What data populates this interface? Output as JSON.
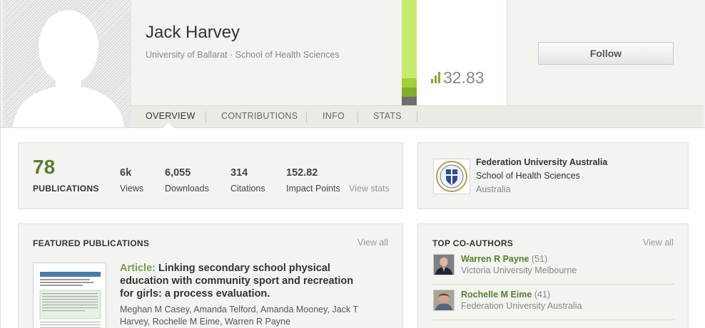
{
  "profile": {
    "name": "Jack Harvey",
    "affiliation": "University of Ballarat · School of Health Sciences",
    "score": "32.83",
    "follow_label": "Follow"
  },
  "tabs": [
    {
      "label": "OVERVIEW",
      "active": true
    },
    {
      "label": "CONTRIBUTIONS",
      "active": false
    },
    {
      "label": "INFO",
      "active": false
    },
    {
      "label": "STATS",
      "active": false
    }
  ],
  "stats": {
    "publications_count": "78",
    "publications_label": "PUBLICATIONS",
    "items": [
      {
        "value": "6k",
        "label": "Views"
      },
      {
        "value": "6,055",
        "label": "Downloads"
      },
      {
        "value": "314",
        "label": "Citations"
      },
      {
        "value": "152.82",
        "label": "Impact Points"
      }
    ],
    "view_stats_label": "View stats"
  },
  "institution": {
    "name": "Federation University Australia",
    "department": "School of Health Sciences",
    "country": "Australia"
  },
  "featured": {
    "title": "FEATURED PUBLICATIONS",
    "view_all": "View all",
    "article_type": "Article:",
    "article_title": "Linking secondary school physical education with community sport and recreation for girls: a process evaluation.",
    "authors": "Meghan M Casey, Amanda Telford, Amanda Mooney, Jack T Harvey, Rochelle M Eime, Warren R Payne"
  },
  "coauthors": {
    "title": "TOP CO-AUTHORS",
    "view_all": "View all",
    "items": [
      {
        "name": "Warren R Payne",
        "count": "(51)",
        "affiliation": "Victoria University Melbourne"
      },
      {
        "name": "Rochelle M Eime",
        "count": "(41)",
        "affiliation": "Federation University Australia"
      }
    ]
  },
  "colors": {
    "accent_green": "#5b7d2e",
    "score_bar_light": "#c7ea6e",
    "score_bar_dark": "#7fae2a"
  }
}
